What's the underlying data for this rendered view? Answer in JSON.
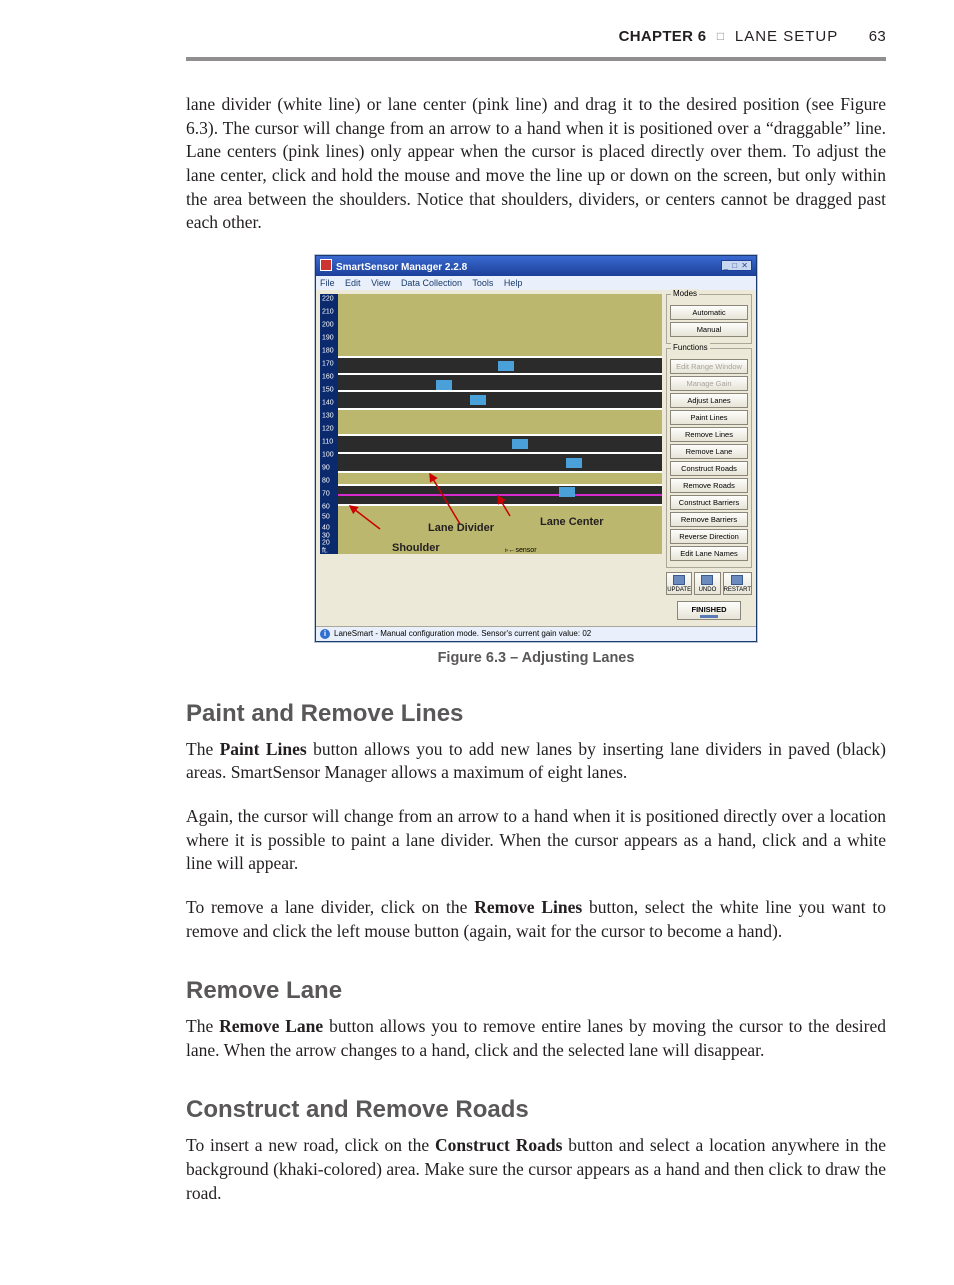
{
  "header": {
    "chapter": "CHAPTER 6",
    "section": "LANE SETUP",
    "page": "63"
  },
  "para1": "lane divider (white line) or lane center (pink line) and drag it to the desired position (see Figure 6.3). The cursor will change from an arrow to a hand when it is positioned over a “draggable” line. Lane centers (pink lines) only appear when the cursor is placed directly over them. To adjust the lane center, click and hold the mouse and move the line up or down on the screen, but only within the area between the shoulders. Notice that shoulders, dividers, or centers cannot be dragged past each other.",
  "figure": {
    "title": "SmartSensor Manager 2.2.8",
    "menus": [
      "File",
      "Edit",
      "View",
      "Data Collection",
      "Tools",
      "Help"
    ],
    "yticks": [
      "220",
      "210",
      "200",
      "190",
      "180",
      "170",
      "160",
      "150",
      "140",
      "130",
      "120",
      "110",
      "100",
      "90",
      "80",
      "70",
      "60",
      "50",
      "40",
      "30",
      "20",
      "ft."
    ],
    "annotations": {
      "laneCenter": "Lane Center",
      "laneDivider": "Lane Divider",
      "shoulder": "Shoulder",
      "sensor": "sensor"
    },
    "side": {
      "modesTitle": "Modes",
      "automatic": "Automatic",
      "manual": "Manual",
      "functionsTitle": "Functions",
      "buttons": [
        "Edit Range Window",
        "Manage Gain",
        "Adjust Lanes",
        "Paint Lines",
        "Remove Lines",
        "Remove Lane",
        "Construct Roads",
        "Remove Roads",
        "Construct Barriers",
        "Remove Barriers",
        "Reverse Direction",
        "Edit Lane Names"
      ],
      "iconLabels": [
        "UPDATE",
        "UNDO",
        "RESTART"
      ],
      "finished": "FINISHED"
    },
    "status": "LaneSmart - Manual configuration mode.   Sensor's current gain value: 02",
    "caption": "Figure 6.3 – Adjusting Lanes"
  },
  "sec1": {
    "title": "Paint and Remove Lines",
    "p1a": "The ",
    "p1b": "Paint Lines",
    "p1c": " button allows you to add new lanes by inserting lane dividers in paved (black) areas. SmartSensor Manager allows a maximum of eight lanes.",
    "p2": "Again, the cursor will change from an arrow to a hand when it is positioned directly over a location where it is possible to paint a lane divider. When the cursor appears as a hand, click and a white line will appear.",
    "p3a": "To remove a lane divider, click on the ",
    "p3b": "Remove Lines",
    "p3c": " button, select the white line you want to remove and click the left mouse button (again, wait for the cursor to become a hand)."
  },
  "sec2": {
    "title": "Remove Lane",
    "p1a": "The ",
    "p1b": "Remove Lane",
    "p1c": " button allows you to remove entire lanes by moving the cursor to the desired lane. When the arrow changes to a hand, click and the selected lane will disappear."
  },
  "sec3": {
    "title": "Construct and Remove Roads",
    "p1a": "To insert a new road, click on the ",
    "p1b": "Construct Roads",
    "p1c": " button and select a location anywhere in the background (khaki-colored) area. Make sure the cursor appears as a hand and then click to draw the road."
  }
}
